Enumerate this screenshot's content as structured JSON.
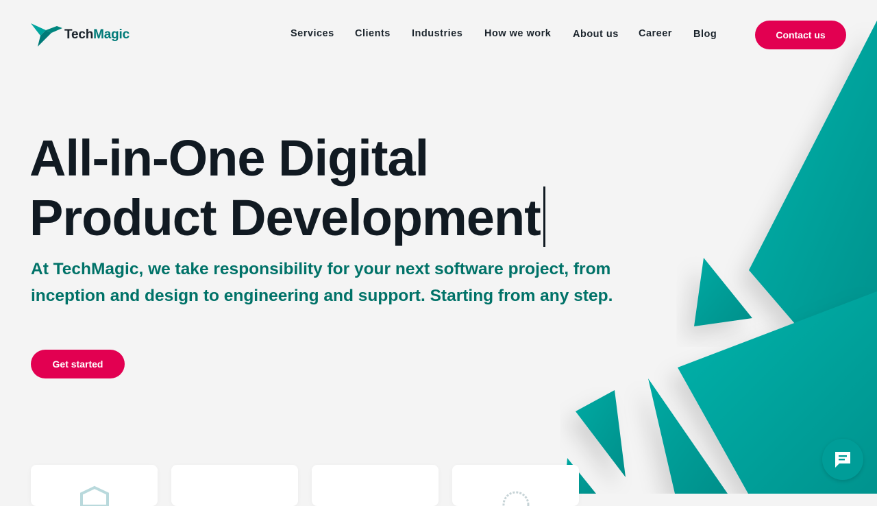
{
  "brand": {
    "name_part1": "Tech",
    "name_part2": "Magic",
    "accent": "#007a78",
    "primary": "#e20051",
    "teal": "#00a7a1"
  },
  "nav": {
    "items": [
      {
        "label": "Services"
      },
      {
        "label": "Clients"
      },
      {
        "label": "Industries"
      },
      {
        "label": "How we work"
      },
      {
        "label": "About us"
      },
      {
        "label": "Career"
      },
      {
        "label": "Blog"
      }
    ],
    "cta_label": "Contact us"
  },
  "hero": {
    "title_line1": "All-in-One Digital",
    "title_line2": "Product Development",
    "subtitle": "At TechMagic, we take responsibility for your next software project, from inception and design to engineering and support. Starting from any step.",
    "cta_label": "Get started"
  },
  "icons": {
    "logo": "hummingbird-logo-icon",
    "chat": "chat-icon",
    "card1": "shield-badge-icon",
    "card4": "seal-badge-icon"
  }
}
